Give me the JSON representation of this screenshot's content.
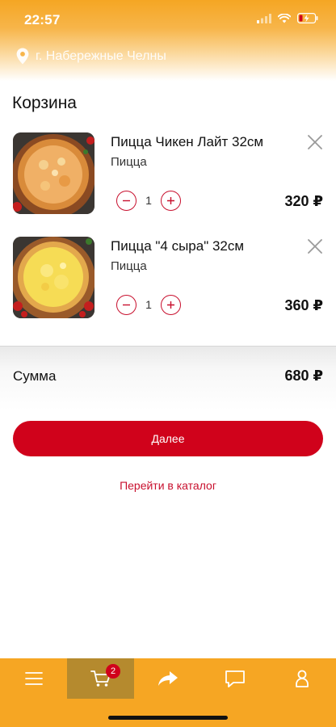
{
  "status_bar": {
    "time": "22:57"
  },
  "header": {
    "location": "г. Набережные Челны"
  },
  "page": {
    "title": "Корзина"
  },
  "cart": {
    "items": [
      {
        "name": "Пицца Чикен Лайт 32см",
        "category": "Пицца",
        "quantity": "1",
        "price": "320 ₽",
        "image": "pizza-chicken-light"
      },
      {
        "name": "Пицца \"4 сыра\" 32см",
        "category": "Пицца",
        "quantity": "1",
        "price": "360 ₽",
        "image": "pizza-4-cheese"
      }
    ],
    "sum_label": "Сумма",
    "sum_value": "680 ₽",
    "next_label": "Далее",
    "catalog_label": "Перейти в каталог"
  },
  "bottom_nav": {
    "items": [
      {
        "icon": "menu-icon"
      },
      {
        "icon": "cart-icon",
        "badge": "2",
        "active": true
      },
      {
        "icon": "share-icon"
      },
      {
        "icon": "chat-icon"
      },
      {
        "icon": "profile-icon"
      }
    ]
  },
  "colors": {
    "accent": "#f6a623",
    "primary": "#d0021b",
    "active_tab": "#b58a2e"
  }
}
